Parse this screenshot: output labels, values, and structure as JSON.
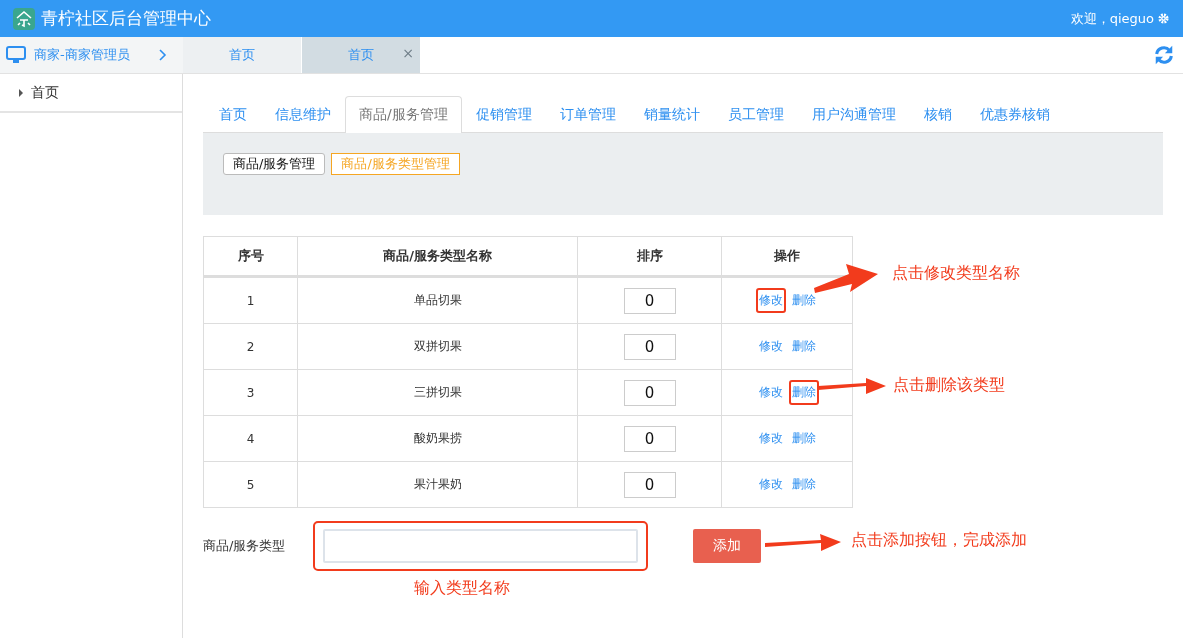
{
  "header": {
    "title": "青柠社区后台管理中心",
    "welcome": "欢迎，qieguo"
  },
  "sidebar": {
    "role": "商家-商家管理员",
    "items": [
      {
        "label": "首页",
        "selected": false
      }
    ]
  },
  "page_tabs": [
    {
      "label": "首页",
      "selected": false
    },
    {
      "label": "首页",
      "selected": true,
      "close": "×"
    }
  ],
  "nav_tabs": [
    {
      "label": "首页",
      "selected": false
    },
    {
      "label": "信息维护",
      "selected": false
    },
    {
      "label": "商品/服务管理",
      "selected": true
    },
    {
      "label": "促销管理",
      "selected": false
    },
    {
      "label": "订单管理",
      "selected": false
    },
    {
      "label": "销量统计",
      "selected": false
    },
    {
      "label": "员工管理",
      "selected": false
    },
    {
      "label": "用户沟通管理",
      "selected": false
    },
    {
      "label": "核销",
      "selected": false
    },
    {
      "label": "优惠券核销",
      "selected": false
    }
  ],
  "sub_tabs": [
    {
      "label": "商品/服务管理",
      "selected": false
    },
    {
      "label": "商品/服务类型管理",
      "selected": true
    }
  ],
  "table": {
    "columns": [
      "序号",
      "商品/服务类型名称",
      "排序",
      "操作"
    ],
    "rows": [
      {
        "index": "1",
        "name": "单品切果",
        "order": "0",
        "edit": "修改",
        "delete": "删除",
        "edit_highlighted": true,
        "delete_highlighted": false
      },
      {
        "index": "2",
        "name": "双拼切果",
        "order": "0",
        "edit": "修改",
        "delete": "删除",
        "edit_highlighted": false,
        "delete_highlighted": false
      },
      {
        "index": "3",
        "name": "三拼切果",
        "order": "0",
        "edit": "修改",
        "delete": "删除",
        "edit_highlighted": false,
        "delete_highlighted": true
      },
      {
        "index": "4",
        "name": "酸奶果捞",
        "order": "0",
        "edit": "修改",
        "delete": "删除",
        "edit_highlighted": false,
        "delete_highlighted": false
      },
      {
        "index": "5",
        "name": "果汁果奶",
        "order": "0",
        "edit": "修改",
        "delete": "删除",
        "edit_highlighted": false,
        "delete_highlighted": false
      }
    ]
  },
  "form": {
    "label": "商品/服务类型",
    "input_highlighted": true,
    "button": "添加"
  },
  "annotations": [
    {
      "text": "点击修改类型名称"
    },
    {
      "text": "点击删除该类型"
    },
    {
      "text": "点击添加按钮，完成添加"
    },
    {
      "text": "输入类型名称"
    }
  ]
}
